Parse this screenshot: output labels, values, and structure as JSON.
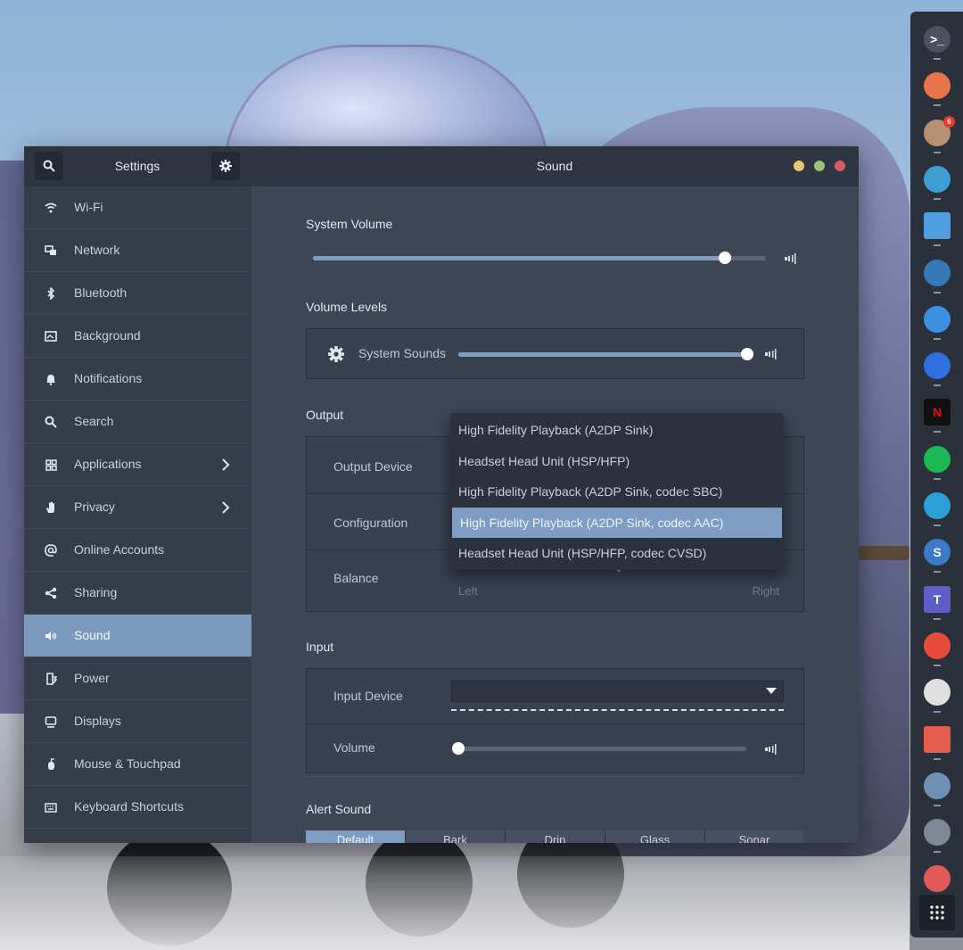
{
  "window": {
    "sidebar_title": "Settings",
    "title": "Sound",
    "controls": {
      "minimize_color": "#e8c56e",
      "maximize_color": "#9bc27a",
      "close_color": "#d9596a"
    }
  },
  "sidebar": {
    "items": [
      {
        "label": "Wi-Fi",
        "icon": "wifi-icon"
      },
      {
        "label": "Network",
        "icon": "network-icon"
      },
      {
        "label": "Bluetooth",
        "icon": "bluetooth-icon"
      },
      {
        "label": "Background",
        "icon": "background-icon"
      },
      {
        "label": "Notifications",
        "icon": "bell-icon"
      },
      {
        "label": "Search",
        "icon": "search-icon"
      },
      {
        "label": "Applications",
        "icon": "grid-icon",
        "has_chevron": true
      },
      {
        "label": "Privacy",
        "icon": "hand-icon",
        "has_chevron": true
      },
      {
        "label": "Online Accounts",
        "icon": "at-icon"
      },
      {
        "label": "Sharing",
        "icon": "share-icon"
      },
      {
        "label": "Sound",
        "icon": "speaker-icon",
        "active": true
      },
      {
        "label": "Power",
        "icon": "power-icon"
      },
      {
        "label": "Displays",
        "icon": "display-icon"
      },
      {
        "label": "Mouse & Touchpad",
        "icon": "mouse-icon"
      },
      {
        "label": "Keyboard Shortcuts",
        "icon": "keyboard-icon"
      }
    ]
  },
  "sound": {
    "system_volume": {
      "heading": "System Volume",
      "level": 0.91
    },
    "volume_levels": {
      "heading": "Volume Levels",
      "system_sounds_label": "System Sounds",
      "level": 1.0
    },
    "output": {
      "heading": "Output",
      "device_label": "Output Device",
      "configuration_label": "Configuration",
      "balance_label": "Balance",
      "balance_left": "Left",
      "balance_right": "Right",
      "balance_value": 0.5,
      "dropdown_options": [
        "High Fidelity Playback (A2DP Sink)",
        "Headset Head Unit (HSP/HFP)",
        "High Fidelity Playback (A2DP Sink, codec SBC)",
        "High Fidelity Playback (A2DP Sink, codec AAC)",
        "Headset Head Unit (HSP/HFP, codec CVSD)"
      ],
      "selected_index": 3
    },
    "input": {
      "heading": "Input",
      "device_label": "Input Device",
      "device_value": "",
      "volume_label": "Volume",
      "volume_level": 0.0
    },
    "alert_sound": {
      "heading": "Alert Sound",
      "options": [
        "Default",
        "Bark",
        "Drip",
        "Glass",
        "Sonar"
      ],
      "selected": "Default"
    }
  },
  "dock": {
    "apps": [
      {
        "name": "terminal-icon",
        "color": "#4a5260",
        "glyph": ">_"
      },
      {
        "name": "firefox-icon",
        "color": "#e8734a",
        "glyph": ""
      },
      {
        "name": "mail-icon",
        "color": "#b59072",
        "glyph": "",
        "badge": "6"
      },
      {
        "name": "gaming-app-icon",
        "color": "#3d9fd1",
        "glyph": ""
      },
      {
        "name": "files-icon",
        "color": "#4f9ee0",
        "glyph": ""
      },
      {
        "name": "steam-icon",
        "color": "#3578b5",
        "glyph": ""
      },
      {
        "name": "audio-monitor-icon",
        "color": "#3d8fe0",
        "glyph": ""
      },
      {
        "name": "signal-icon",
        "color": "#2f6fe0",
        "glyph": ""
      },
      {
        "name": "netflix-icon",
        "color": "#111111",
        "glyph": "N"
      },
      {
        "name": "spotify-icon",
        "color": "#1db954",
        "glyph": ""
      },
      {
        "name": "kodi-icon",
        "color": "#2b9fd6",
        "glyph": ""
      },
      {
        "name": "simplenote-icon",
        "color": "#3a7bc8",
        "glyph": "S"
      },
      {
        "name": "teams-icon",
        "color": "#5b5fc7",
        "glyph": "T"
      },
      {
        "name": "sad-face-icon",
        "color": "#e84b3c",
        "glyph": ""
      },
      {
        "name": "chrome-icon",
        "color": "#e0e0e0",
        "glyph": ""
      },
      {
        "name": "presentation-icon",
        "color": "#e65c4f",
        "glyph": ""
      },
      {
        "name": "mixer-icon",
        "color": "#6f8fb3",
        "glyph": ""
      },
      {
        "name": "settings-icon",
        "color": "#7f8896",
        "glyph": ""
      },
      {
        "name": "trash-icon",
        "color": "#e05a5a",
        "glyph": ""
      }
    ],
    "app_grid_icon": "app-grid-icon"
  }
}
